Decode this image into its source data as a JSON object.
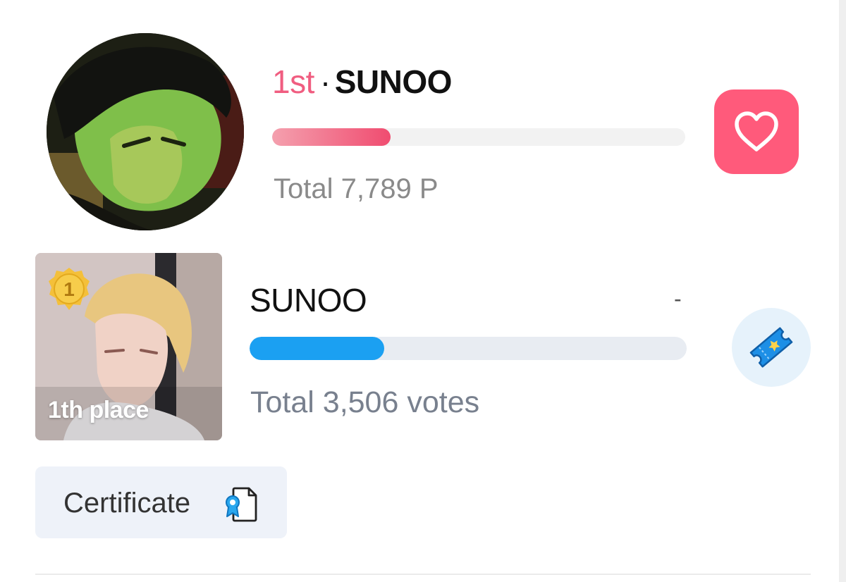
{
  "daily_rank": {
    "rank_label": "1st",
    "separator": "·",
    "name": "SUNOO",
    "progress_percent": 28.7,
    "total_text": "Total 7,789 P",
    "colors": {
      "rank": "#f05d80",
      "button": "#ff5a7b"
    },
    "action_icon": "heart-icon"
  },
  "vote_rank": {
    "medal_number": "1",
    "place_label": "1th place",
    "name": "SUNOO",
    "rank_change": "-",
    "progress_percent": 30.8,
    "total_text": "Total 3,506 votes",
    "colors": {
      "bar": "#1ba0f2"
    },
    "action_icon": "ticket-icon"
  },
  "certificate": {
    "label": "Certificate",
    "icon": "certificate-icon"
  }
}
